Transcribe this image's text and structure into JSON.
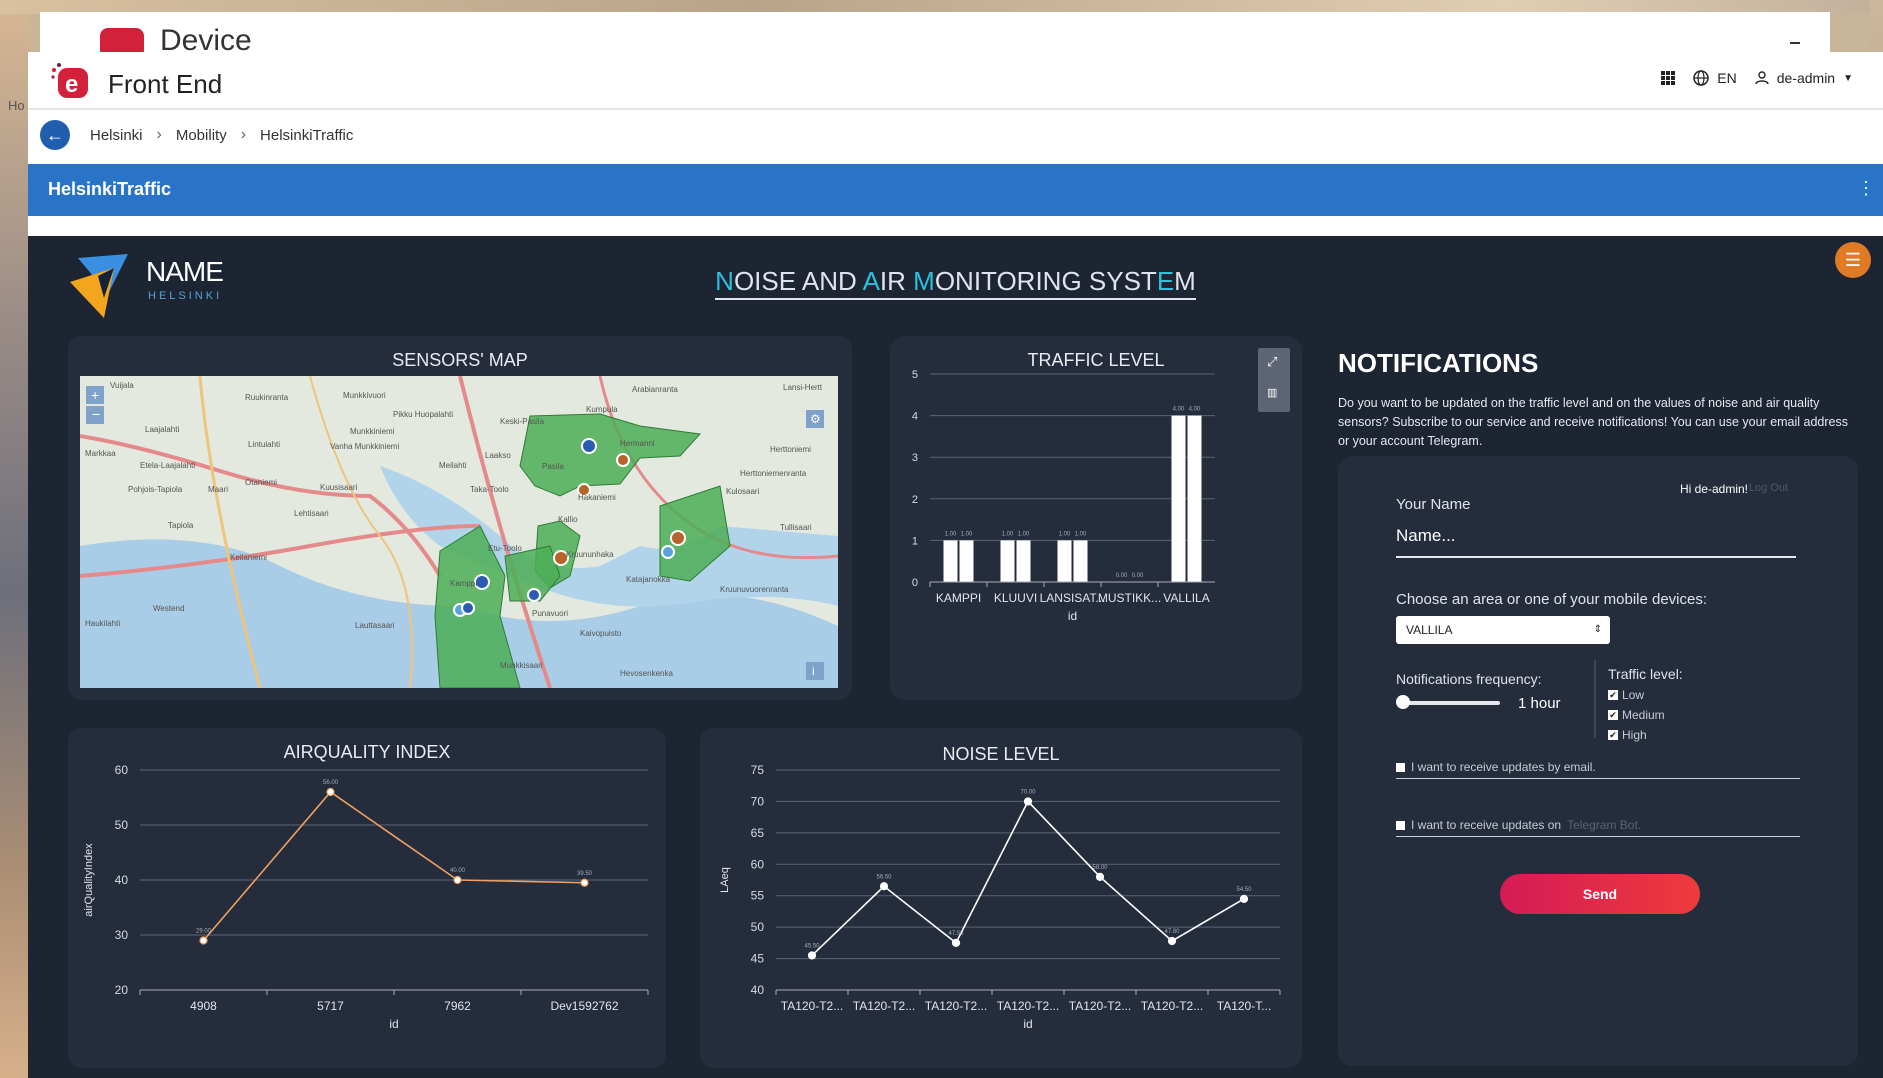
{
  "background": {
    "ghost_title": "Device",
    "ghost_left": "Ho"
  },
  "app": {
    "title": "Front End",
    "lang": "EN",
    "user": "de-admin"
  },
  "breadcrumb": [
    "Helsinki",
    "Mobility",
    "HelsinkiTraffic"
  ],
  "page_title": "HelsinkiTraffic",
  "brand": {
    "name": "NAME",
    "sub": "HELSINKI"
  },
  "dashboard_title": {
    "p1": "N",
    "p2": "OISE AND ",
    "p3": "A",
    "p4": "IR ",
    "p5": "M",
    "p6": "ONITORING SYST",
    "p7": "E",
    "p8": "M"
  },
  "map": {
    "title": "SENSORS' MAP",
    "place_labels": [
      "Vuijala",
      "Ruukinranta",
      "Munkkivuori",
      "Pikku Huopalahti",
      "Arabianranta",
      "Lansi-Hertt",
      "Laajalahti",
      "Munkkiniemi",
      "Keski-Pasila",
      "Kumpula",
      "Lintulahti",
      "Vanha Munkkiniemi",
      "Meilahti",
      "Laakso",
      "Hermanni",
      "Herttoniemi",
      "Markkaa",
      "Etela-Laajalahti",
      "Otaniemi",
      "Pasila",
      "Herttoniemenranta",
      "Pohjois-Tapiola",
      "Maari",
      "Kuusisaari",
      "Taka-Toolo",
      "Hakaniemi",
      "Kulosaari",
      "Lehtisaari",
      "Tapiola",
      "Kallio",
      "Tullisaari",
      "Etu-Toolo",
      "Kruununhaka",
      "Keilaniemi",
      "Katajanokka",
      "Kruunuvuorenranta",
      "Westend",
      "Kamppi",
      "Kaivopuisto",
      "Haukilahti",
      "Lauttasaari",
      "Punavuori",
      "Hevosenkenka",
      "Munkkisaari",
      "Kaivopuisto"
    ]
  },
  "traffic": {
    "title": "TRAFFIC LEVEL",
    "xlabel": "id"
  },
  "air": {
    "title": "AIRQUALITY INDEX"
  },
  "noise": {
    "title": "NOISE LEVEL"
  },
  "chart_data": [
    {
      "type": "bar",
      "title": "TRAFFIC LEVEL",
      "categories": [
        "KAMPPI",
        "KLUUVI",
        "LANSISAT...",
        "MUSTIKK...",
        "VALLILA"
      ],
      "series": [
        {
          "values": [
            1,
            1,
            1,
            0,
            4
          ]
        },
        {
          "values": [
            1,
            1,
            1,
            0,
            4
          ]
        }
      ],
      "data_labels": [
        "1.00",
        "1.00",
        "1.00",
        "1.00",
        "1.00",
        "1.00",
        "0.00",
        "0.00",
        "4.00",
        "4.00"
      ],
      "xlabel": "id",
      "ylabel": "",
      "ylim": [
        0,
        5
      ],
      "yticks": [
        0,
        1,
        2,
        3,
        4,
        5
      ],
      "grid": true
    },
    {
      "type": "line",
      "title": "AIRQUALITY INDEX",
      "categories": [
        "4908",
        "5717",
        "7962",
        "Dev1592762"
      ],
      "values": [
        29,
        56,
        40,
        39.5
      ],
      "data_labels": [
        "29.00",
        "56.00",
        "40.00",
        "39.50"
      ],
      "xlabel": "id",
      "ylabel": "airQualityIndex",
      "ylim": [
        20,
        60
      ],
      "yticks": [
        20,
        30,
        40,
        50,
        60
      ],
      "color": "#f0a060",
      "grid": true
    },
    {
      "type": "line",
      "title": "NOISE LEVEL",
      "categories": [
        "TA120-T2...",
        "TA120-T2...",
        "TA120-T2...",
        "TA120-T2...",
        "TA120-T2...",
        "TA120-T2...",
        "TA120-T..."
      ],
      "values": [
        45.5,
        56.5,
        47.5,
        70,
        58,
        47.8,
        54.5
      ],
      "data_labels": [
        "45.50",
        "56.50",
        "47.50",
        "70.00",
        "58.00",
        "47.80",
        "54.50"
      ],
      "xlabel": "id",
      "ylabel": "LAeq",
      "ylim": [
        40,
        75
      ],
      "yticks": [
        40,
        45,
        50,
        55,
        60,
        65,
        70,
        75
      ],
      "color": "#ffffff",
      "grid": true
    }
  ],
  "notifications": {
    "title": "NOTIFICATIONS",
    "description": "Do you want to be updated on the traffic level and on the values of noise and air quality sensors? Subscribe to our service and receive notifications! You can use your email address or your account Telegram.",
    "hi": "Hi de-admin!",
    "logout": "Log Out",
    "name_label": "Your Name",
    "name_placeholder": "Name...",
    "area_label": "Choose an area or one of your mobile devices:",
    "area_value": "VALLILA",
    "freq_label": "Notifications frequency:",
    "freq_value": "1 hour",
    "traffic_label": "Traffic level:",
    "levels": [
      "Low",
      "Medium",
      "High"
    ],
    "email_opt": "I want to receive updates by email.",
    "telegram_opt": "I want to receive updates on",
    "telegram_link": "Telegram Bot.",
    "send": "Send"
  }
}
